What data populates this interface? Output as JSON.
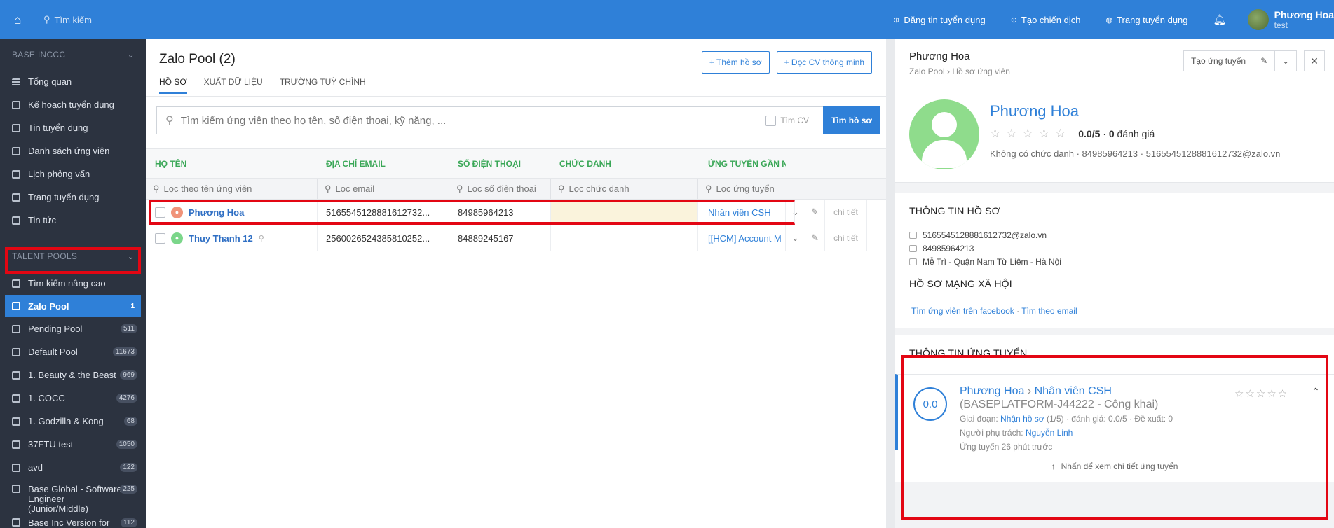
{
  "topbar": {
    "search_placeholder": "Tìm kiếm",
    "links": [
      "Đăng tin tuyển dụng",
      "Tạo chiến dịch",
      "Trang tuyển dụng"
    ],
    "user_name": "Phương Hoa",
    "user_role": "test"
  },
  "sidebar": {
    "section1": "BASE INCCC",
    "items1": [
      "Tổng quan",
      "Kế hoạch tuyển dụng",
      "Tin tuyển dụng",
      "Danh sách ứng viên",
      "Lịch phỏng vấn",
      "Trang tuyển dụng",
      "Tin tức"
    ],
    "section2": "TALENT POOLS",
    "pools": [
      {
        "label": "Tìm kiếm nâng cao",
        "count": ""
      },
      {
        "label": "Zalo Pool",
        "count": "1"
      },
      {
        "label": "Pending Pool",
        "count": "511"
      },
      {
        "label": "Default Pool",
        "count": "11673"
      },
      {
        "label": "1. Beauty & the Beast",
        "count": "969"
      },
      {
        "label": "1. COCC",
        "count": "4276"
      },
      {
        "label": "1. Godzilla & Kong",
        "count": "68"
      },
      {
        "label": "37FTU test",
        "count": "1050"
      },
      {
        "label": "avd",
        "count": "122"
      },
      {
        "label": "Base Global - Software Engineer (Junior/Middle)",
        "count": "225"
      },
      {
        "label": "Base Inc Version for Tester",
        "count": "112"
      }
    ]
  },
  "main": {
    "title": "Zalo Pool (2)",
    "tabs": [
      "HỒ SƠ",
      "XUẤT DỮ LIỆU",
      "TRƯỜNG TUỲ CHỈNH"
    ],
    "add_button": "+ Thêm hồ sơ",
    "cv_button": "+ Đọc CV thông minh",
    "search_placeholder": "Tìm kiếm ứng viên theo họ tên, số điện thoại, kỹ năng, ...",
    "cv_label": "Tìm CV",
    "search_button": "Tìm hồ sơ",
    "columns": [
      "HỌ TÊN",
      "ĐỊA CHỈ EMAIL",
      "SỐ ĐIỆN THOẠI",
      "CHỨC DANH",
      "ỨNG TUYỂN GẦN N"
    ],
    "filters": [
      "Lọc theo tên ứng viên",
      "Lọc email",
      "Lọc số điện thoại",
      "Lọc chức danh",
      "Lọc ứng tuyển"
    ],
    "rows": [
      {
        "name": "Phương Hoa",
        "email": "5165545128881612732...",
        "phone": "84985964213",
        "title": "",
        "apply": "Nhân viên CSH",
        "detail": "chi tiết"
      },
      {
        "name": "Thuy Thanh 12",
        "email": "2560026524385810252...",
        "phone": "84889245167",
        "title": "",
        "apply": "[[HCM] Account M",
        "detail": "chi tiết"
      }
    ]
  },
  "panel": {
    "name": "Phương Hoa",
    "breadcrumb": "Zalo Pool › Hồ sơ ứng viên",
    "create_button": "Tạo ứng tuyển",
    "score_text": "0.0/5",
    "rating_count": "0",
    "rating_label": "đánh giá",
    "meta": "Không có chức danh · 84985964213 · 5165545128881612732@zalo.vn",
    "info_title": "THÔNG TIN HỒ SƠ",
    "email": "5165545128881612732@zalo.vn",
    "phone": "84985964213",
    "address": "Mễ Trì - Quận Nam Từ Liêm - Hà Nội",
    "social_title": "HỒ SƠ MẠNG XÃ HỘI",
    "fb_link": "Tìm ứng viên trên facebook",
    "email_link": "Tìm theo email",
    "apply_title": "THÔNG TIN ỨNG TUYỂN",
    "apply": {
      "score": "0.0",
      "candidate": "Phương Hoa",
      "job": "Nhân viên CSH",
      "job_code": "(BASEPLATFORM-J44222 - Công khai)",
      "stage_label": "Giai đoạn:",
      "stage": "Nhận hồ sơ",
      "stage_rest": "(1/5) · đánh giá: 0.0/5 · Đề xuất: 0",
      "owner_label": "Người phụ trách:",
      "owner": "Nguyễn Linh",
      "time": "Ứng tuyển 26 phút trước",
      "footer": "Nhấn để xem chi tiết ứng tuyển"
    }
  }
}
